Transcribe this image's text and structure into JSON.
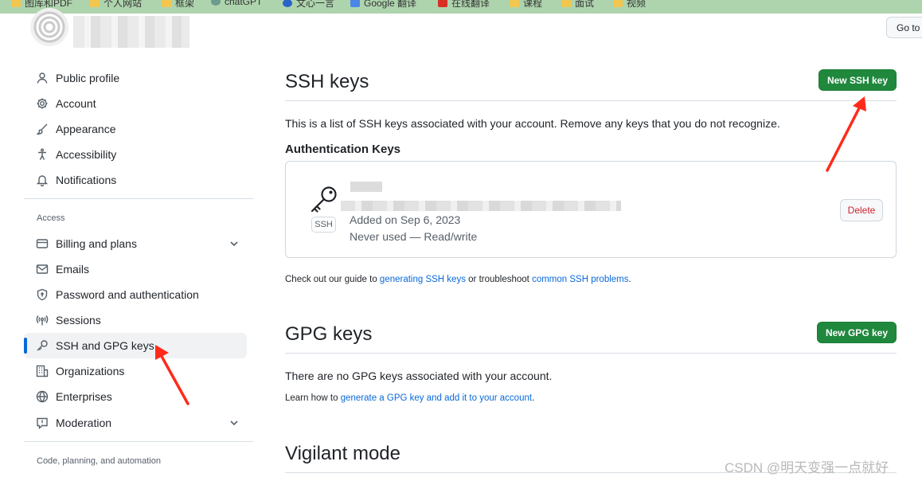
{
  "bookmarks": [
    {
      "label": "图库和PDF",
      "icon": "folder-icon"
    },
    {
      "label": "个人网站",
      "icon": "folder-icon"
    },
    {
      "label": "框架",
      "icon": "folder-icon"
    },
    {
      "label": "chatGPT",
      "icon": "chatgpt-icon"
    },
    {
      "label": "文心一言",
      "icon": "wenxin-icon"
    },
    {
      "label": "Google 翻译",
      "icon": "google-translate-icon"
    },
    {
      "label": "在线翻译",
      "icon": "translate-icon"
    },
    {
      "label": "课程",
      "icon": "folder-icon"
    },
    {
      "label": "面试",
      "icon": "folder-icon"
    },
    {
      "label": "视频",
      "icon": "folder-icon"
    }
  ],
  "header": {
    "goto_label": "Go to"
  },
  "sidebar": {
    "items_top": [
      {
        "label": "Public profile",
        "icon": "person-icon"
      },
      {
        "label": "Account",
        "icon": "gear-icon"
      },
      {
        "label": "Appearance",
        "icon": "paintbrush-icon"
      },
      {
        "label": "Accessibility",
        "icon": "accessibility-icon"
      },
      {
        "label": "Notifications",
        "icon": "bell-icon"
      }
    ],
    "access_heading": "Access",
    "items_access": [
      {
        "label": "Billing and plans",
        "icon": "credit-card-icon"
      },
      {
        "label": "Emails",
        "icon": "mail-icon"
      },
      {
        "label": "Password and authentication",
        "icon": "shield-icon"
      },
      {
        "label": "Sessions",
        "icon": "broadcast-icon"
      },
      {
        "label": "SSH and GPG keys",
        "icon": "key-icon"
      },
      {
        "label": "Organizations",
        "icon": "organization-icon"
      },
      {
        "label": "Enterprises",
        "icon": "globe-icon"
      },
      {
        "label": "Moderation",
        "icon": "report-icon"
      }
    ],
    "code_heading": "Code, planning, and automation"
  },
  "ssh": {
    "title": "SSH keys",
    "new_button": "New SSH key",
    "description": "This is a list of SSH keys associated with your account. Remove any keys that you do not recognize.",
    "auth_heading": "Authentication Keys",
    "key": {
      "badge": "SSH",
      "added": "Added on Sep 6, 2023",
      "usage": "Never used — Read/write",
      "delete_label": "Delete"
    },
    "guide_prefix": "Check out our guide to ",
    "guide_link1": "generating SSH keys",
    "guide_middle": " or troubleshoot ",
    "guide_link2": "common SSH problems",
    "guide_suffix": "."
  },
  "gpg": {
    "title": "GPG keys",
    "new_button": "New GPG key",
    "empty_text": "There are no GPG keys associated with your account.",
    "learn_prefix": "Learn how to ",
    "learn_link": "generate a GPG key and add it to your account",
    "learn_suffix": "."
  },
  "vigilant": {
    "title": "Vigilant mode"
  },
  "watermark": "CSDN @明天变强一点就好",
  "colors": {
    "primary_green": "#1f883d",
    "link_blue": "#0969da",
    "danger_red": "#cf222e",
    "annotation_red": "#ff2a1a"
  }
}
